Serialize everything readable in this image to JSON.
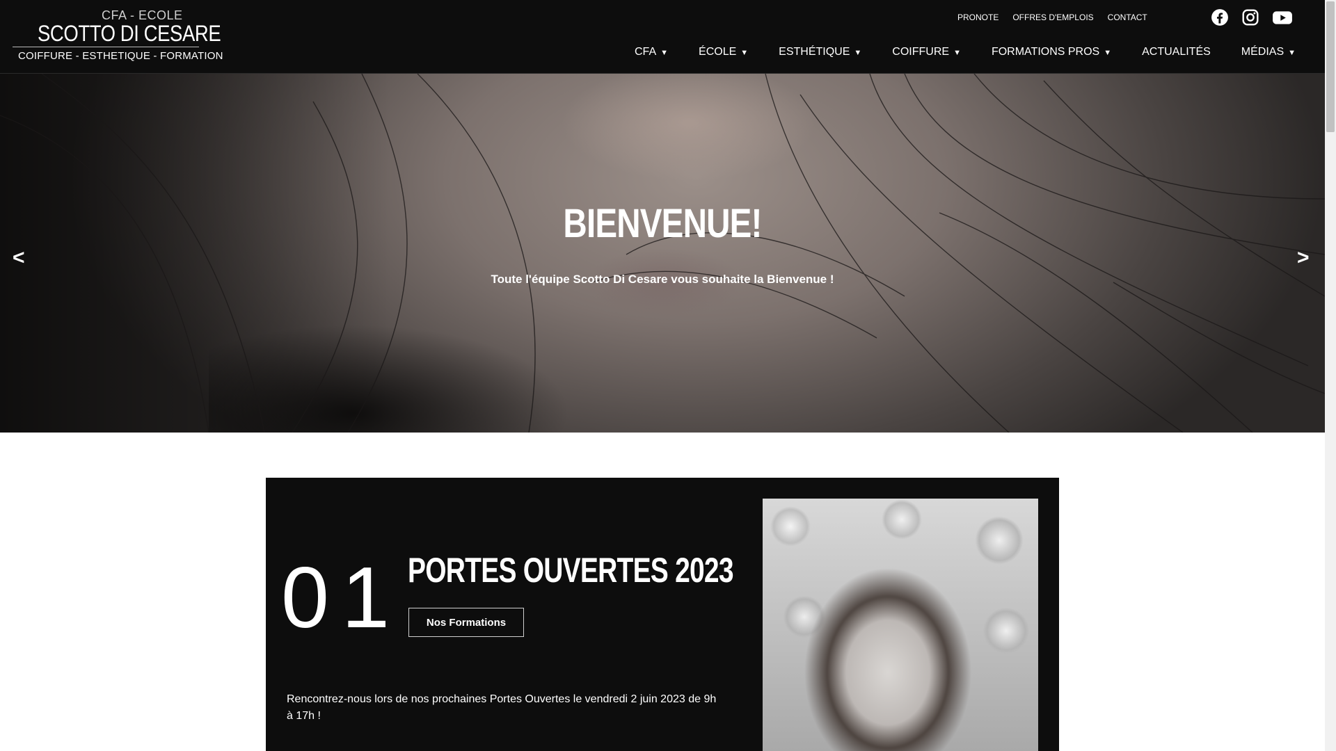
{
  "logo": {
    "line1": "CFA - ECOLE",
    "line2": "SCOTTO DI CESARE",
    "line3": "COIFFURE - ESTHETIQUE - FORMATION"
  },
  "top_links": [
    "PRONOTE",
    "OFFRES D'EMPLOIS",
    "CONTACT"
  ],
  "social": [
    "facebook-icon",
    "instagram-icon",
    "youtube-icon"
  ],
  "nav": [
    {
      "label": "CFA",
      "caret": "▼"
    },
    {
      "label": "ÉCOLE",
      "caret": "▼"
    },
    {
      "label": "ESTHÉTIQUE",
      "caret": "▼"
    },
    {
      "label": "COIFFURE",
      "caret": "▼"
    },
    {
      "label": "FORMATIONS PROS",
      "caret": "▼"
    },
    {
      "label": "ACTUALITÉS",
      "caret": ""
    },
    {
      "label": "MÉDIAS",
      "caret": "▼"
    }
  ],
  "hero": {
    "title": "BIENVENUE!",
    "subtitle": "Toute l'équipe Scotto Di Cesare vous souhaite la Bienvenue !",
    "prev_arrow": "<",
    "next_arrow": ">"
  },
  "card": {
    "number": "01",
    "title": "PORTES OUVERTES 2023",
    "button": "Nos Formations",
    "text": "Rencontrez-nous lors de nos prochaines Portes Ouvertes le vendredi 2 juin 2023 de 9h à 17h !"
  },
  "colors": {
    "header_bg": "#0d0d0d",
    "card_bg": "#0d0d0d",
    "text": "#ffffff"
  }
}
